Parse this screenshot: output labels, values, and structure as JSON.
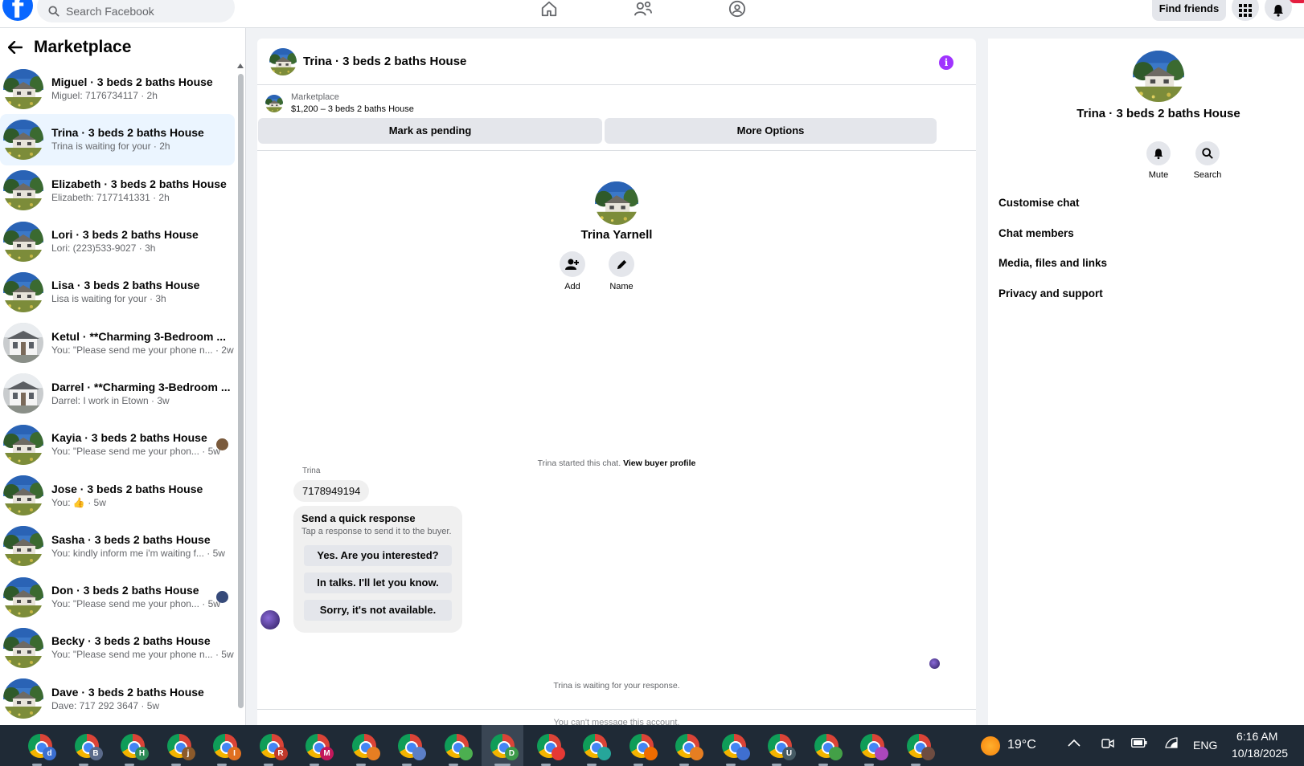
{
  "topbar": {
    "search_placeholder": "Search Facebook",
    "find_friends": "Find friends",
    "logo": "f"
  },
  "marketplace": {
    "title": "Marketplace",
    "conversations": [
      {
        "name": "Miguel · 3 beds 2 baths House",
        "sub": "Miguel: 7176734117 · 2h"
      },
      {
        "name": "Trina · 3 beds 2 baths House",
        "sub": "Trina is waiting for your · 2h"
      },
      {
        "name": "Elizabeth · 3 beds 2 baths House",
        "sub": "Elizabeth: 7177141331 · 2h"
      },
      {
        "name": "Lori · 3 beds 2 baths House",
        "sub": "Lori: (223)533-9027 · 3h"
      },
      {
        "name": "Lisa · 3 beds 2 baths House",
        "sub": "Lisa is waiting for your · 3h"
      },
      {
        "name": "Ketul · **Charming 3-Bedroom ...",
        "sub": "You: \"Please send me your phone n... · 2w"
      },
      {
        "name": "Darrel · **Charming 3-Bedroom ...",
        "sub": "Darrel: I work in Etown · 3w"
      },
      {
        "name": "Kayia · 3 beds 2 baths House",
        "sub": "You: \"Please send me your phon... · 5w"
      },
      {
        "name": "Jose · 3 beds 2 baths House",
        "sub": "You: 👍 · 5w"
      },
      {
        "name": "Sasha · 3 beds 2 baths House",
        "sub": "You: kindly inform me i'm waiting f... · 5w"
      },
      {
        "name": "Don · 3 beds 2 baths House",
        "sub": "You: \"Please send me your phon... · 5w"
      },
      {
        "name": "Becky · 3 beds 2 baths House",
        "sub": "You: \"Please send me your phone n... · 5w"
      },
      {
        "name": "Dave · 3 beds 2 baths House",
        "sub": "Dave: 717 292 3647 · 5w"
      }
    ]
  },
  "chat": {
    "header_title": "Trina · 3 beds 2 baths House",
    "listing_category": "Marketplace",
    "listing_price": "$1,200 – 3 beds 2 baths House",
    "mark_pending": "Mark as pending",
    "more_options": "More Options",
    "profile_name": "Trina Yarnell",
    "add_label": "Add",
    "name_label": "Name",
    "started_text": "Trina started this chat.",
    "view_buyer_profile": "View buyer profile",
    "sender": "Trina",
    "message": "7178949194",
    "quick_title": "Send a quick response",
    "quick_sub": "Tap a response to send it to the buyer.",
    "quick_responses": [
      "Yes. Are you interested?",
      "In talks. I'll let you know.",
      "Sorry, it's not available."
    ],
    "waiting": "Trina is waiting for your response.",
    "cant_message": "You can't message this account."
  },
  "details": {
    "name": "Trina · 3 beds 2 baths House",
    "mute": "Mute",
    "search": "Search",
    "items": [
      "Customise chat",
      "Chat members",
      "Media, files and links",
      "Privacy and support"
    ]
  },
  "taskbar": {
    "weather": "19°C",
    "language": "ENG",
    "time": "6:16 AM",
    "date": "10/18/2025",
    "apps": [
      {
        "badge": "d",
        "color": "#3b6fd1"
      },
      {
        "badge": "B",
        "color": "#5a6a8a"
      },
      {
        "badge": "H",
        "color": "#2e8b57"
      },
      {
        "badge": "j",
        "color": "#8b5a2b"
      },
      {
        "badge": "I",
        "color": "#e07020"
      },
      {
        "badge": "R",
        "color": "#c0392b"
      },
      {
        "badge": "M",
        "color": "#c2185b"
      },
      {
        "badge": "",
        "color": "#e67e22"
      },
      {
        "badge": "",
        "color": "#5b7fc7"
      },
      {
        "badge": "",
        "color": "#4caf50"
      },
      {
        "badge": "D",
        "color": "#3c9a4a"
      },
      {
        "badge": "",
        "color": "#e53935"
      },
      {
        "badge": "",
        "color": "#26a69a"
      },
      {
        "badge": "",
        "color": "#ef6c00"
      },
      {
        "badge": "",
        "color": "#e67e22"
      },
      {
        "badge": "",
        "color": "#3f6fd0"
      },
      {
        "badge": "U",
        "color": "#455a64"
      },
      {
        "badge": "",
        "color": "#43a047"
      },
      {
        "badge": "",
        "color": "#ab47bc"
      },
      {
        "badge": "",
        "color": "#6d4c41"
      }
    ]
  },
  "colors": {
    "facebook_blue": "#0866ff",
    "info_purple": "#a033ff",
    "active_row": "#ebf5ff"
  }
}
